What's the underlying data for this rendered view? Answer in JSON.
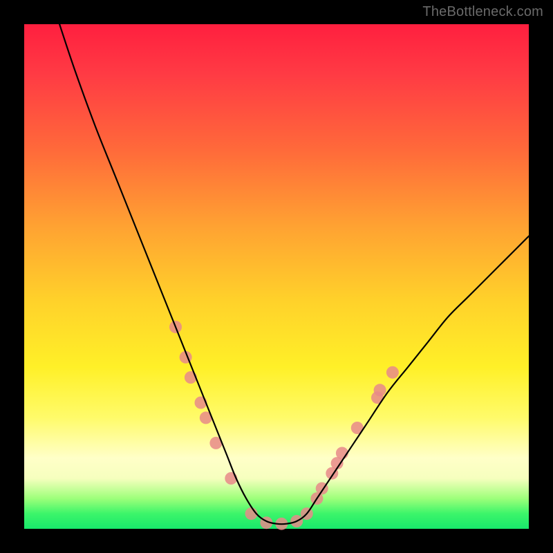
{
  "watermark": "TheBottleneck.com",
  "gradient": {
    "top": "#ff1f3f",
    "upper_mid": "#ffa232",
    "mid": "#fff028",
    "lower_mid": "#ffffc8",
    "bottom": "#18e86b"
  },
  "chart_data": {
    "type": "line",
    "title": "",
    "xlabel": "",
    "ylabel": "",
    "xlim": [
      0,
      100
    ],
    "ylim": [
      0,
      100
    ],
    "grid": false,
    "description": "V-shaped bottleneck curve: steep descent from upper-left to a flat minimum around x≈46–56 at y≈1, then a shallower ascent toward the right edge reaching y≈58 at x=100. Pink circular markers cluster near the trough on both branches.",
    "series": [
      {
        "name": "curve",
        "color": "#000000",
        "x": [
          7,
          10,
          14,
          18,
          22,
          26,
          28,
          30,
          32,
          34,
          36,
          38,
          40,
          42,
          44,
          46,
          48,
          50,
          52,
          54,
          56,
          58,
          60,
          62,
          64,
          66,
          68,
          72,
          76,
          80,
          84,
          88,
          92,
          96,
          100
        ],
        "y": [
          100,
          91,
          80,
          70,
          60,
          50,
          45,
          40,
          35,
          30,
          25,
          20,
          15,
          10,
          6,
          3,
          1.5,
          1,
          1,
          1.5,
          3,
          6,
          9,
          12,
          15,
          18,
          21,
          27,
          32,
          37,
          42,
          46,
          50,
          54,
          58
        ]
      }
    ],
    "markers": {
      "name": "highlight-dots",
      "color": "#e88a8a",
      "radius": 9,
      "points": [
        {
          "x": 30,
          "y": 40
        },
        {
          "x": 32,
          "y": 34
        },
        {
          "x": 33,
          "y": 30
        },
        {
          "x": 35,
          "y": 25
        },
        {
          "x": 36,
          "y": 22
        },
        {
          "x": 38,
          "y": 17
        },
        {
          "x": 41,
          "y": 10
        },
        {
          "x": 45,
          "y": 3
        },
        {
          "x": 48,
          "y": 1.2
        },
        {
          "x": 51,
          "y": 1
        },
        {
          "x": 54,
          "y": 1.5
        },
        {
          "x": 56,
          "y": 3
        },
        {
          "x": 58,
          "y": 6
        },
        {
          "x": 59,
          "y": 8
        },
        {
          "x": 61,
          "y": 11
        },
        {
          "x": 62,
          "y": 13
        },
        {
          "x": 63,
          "y": 15
        },
        {
          "x": 66,
          "y": 20
        },
        {
          "x": 70,
          "y": 26
        },
        {
          "x": 70.5,
          "y": 27.5
        },
        {
          "x": 73,
          "y": 31
        }
      ]
    }
  }
}
